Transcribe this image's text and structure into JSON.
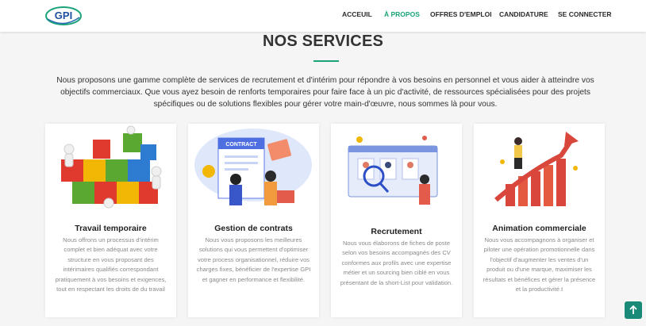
{
  "brand": {
    "logo_text": "GPI",
    "accent": "#1aa37a"
  },
  "nav": {
    "items": [
      {
        "label": "ACCEUIL",
        "active": false
      },
      {
        "label": "À PROPOS",
        "active": true
      },
      {
        "label": "OFFRES D'EMPLOI",
        "active": false
      },
      {
        "label": "CANDIDATURE",
        "active": false
      },
      {
        "label": "SE CONNECTER",
        "active": false
      }
    ]
  },
  "section": {
    "title": "NOS SERVICES",
    "intro": "Nous proposons une gamme complète de services de recrutement et d'intérim pour répondre à vos besoins en personnel et vous aider à atteindre vos objectifs commerciaux. Que vous ayez besoin de renforts temporaires pour faire face à un pic d'activité, de ressources spécialisées pour des projets spécifiques ou de solutions flexibles pour gérer votre main-d'œuvre, nous sommes là pour vous."
  },
  "services": [
    {
      "title": "Travail temporaire",
      "text": "Nous offrons un processus d'intérim complet et bien adéquat avec votre structure en vous proposant des intérimaires qualifiés correspondant pratiquement à vos besoins et exigences, tout en respectant les droits de du travail"
    },
    {
      "title": "Gestion de contrats",
      "illus_label": "CONTRACT",
      "text": "Nous vous proposons les meilleures solutions qui vous permettent d'optimiser votre process organisationnel, réduire vos charges fixes, bénéficier de l'expertise GPI et gagner en performance et flexibilité."
    },
    {
      "title": "Recrutement",
      "text": "Nous vous élaborons de fiches de poste selon vos besoins accompagnés des CV conformes aux profils avec une expertise métier et un sourcing bien ciblé en vous présentant de la short-List pour validation."
    },
    {
      "title": "Animation commerciale",
      "text": "Nous vous accompagnons à organiser et piloter une opération promotionnelle dans l'objectif d'augmenter les ventes d'un produit ou d'une marque, maximiser les résultats et bénéfices et gérer la présence et la productivité.t"
    }
  ],
  "back_to_top": {
    "icon": "arrow-up-icon"
  }
}
